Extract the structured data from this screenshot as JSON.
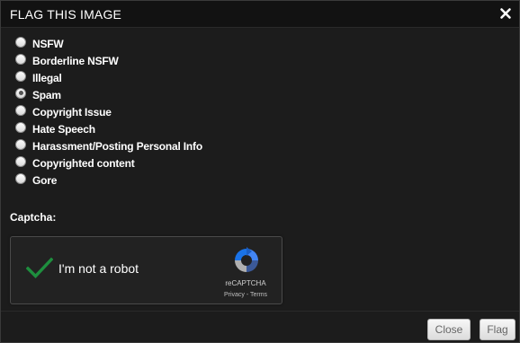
{
  "dialog": {
    "title": "FLAG THIS IMAGE",
    "close_icon": "close-x-icon"
  },
  "options": [
    {
      "label": "NSFW",
      "checked": false
    },
    {
      "label": "Borderline NSFW",
      "checked": false
    },
    {
      "label": "Illegal",
      "checked": false
    },
    {
      "label": "Spam",
      "checked": true
    },
    {
      "label": "Copyright Issue",
      "checked": false
    },
    {
      "label": "Hate Speech",
      "checked": false
    },
    {
      "label": "Harassment/Posting Personal Info",
      "checked": false
    },
    {
      "label": "Copyrighted content",
      "checked": false
    },
    {
      "label": "Gore",
      "checked": false
    }
  ],
  "captcha": {
    "label": "Captcha:",
    "checkbox_text": "I'm not a robot",
    "checked": true,
    "brand": "reCAPTCHA",
    "privacy": "Privacy",
    "separator": " - ",
    "terms": "Terms",
    "check_color": "#1e8e3e"
  },
  "footer": {
    "close_label": "Close",
    "flag_label": "Flag"
  },
  "colors": {
    "background": "#1c1c1c",
    "header": "#121212",
    "text": "#ffffff"
  }
}
